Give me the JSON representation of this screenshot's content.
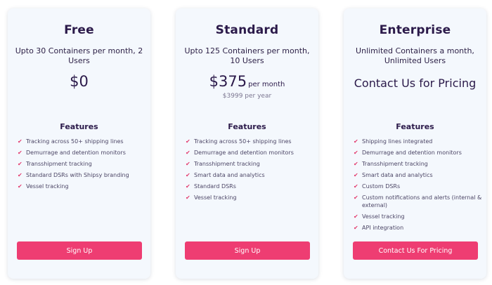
{
  "plans": [
    {
      "name": "Free",
      "description": "Upto 30 Containers per month, 2 Users",
      "price": "$0",
      "features_heading": "Features",
      "features": [
        "Tracking across 50+ shipping lines",
        "Demurrage and detention monitors",
        "Transshipment tracking",
        "Standard DSRs with Shipsy branding",
        "Vessel tracking"
      ],
      "cta_label": "Sign Up"
    },
    {
      "name": "Standard",
      "description": "Upto 125 Containers per month, 10 Users",
      "price": "$375",
      "price_period": "per month",
      "price_yearly": "$3999 per year",
      "features_heading": "Features",
      "features": [
        "Tracking across 50+ shipping lines",
        "Demurrage and detention monitors",
        "Transshipment tracking",
        "Smart data and analytics",
        "Standard DSRs",
        "Vessel tracking"
      ],
      "cta_label": "Sign Up"
    },
    {
      "name": "Enterprise",
      "description": "Unlimited Containers a month, Unlimited Users",
      "contact_text": "Contact Us for Pricing",
      "features_heading": "Features",
      "features": [
        "Shipping lines integrated",
        "Demurrage and detention monitors",
        "Transshipment tracking",
        "Smart data and analytics",
        "Custom DSRs",
        "Custom notifications and alerts (internal & external)",
        "Vessel tracking",
        "API integration"
      ],
      "cta_label": "Contact Us For Pricing"
    }
  ],
  "icons": {
    "feature_check": "check-icon"
  },
  "colors": {
    "accent": "#ee3d72",
    "check": "#e33a6e",
    "card_background": "#f4f8fd",
    "heading": "#2b1a4a"
  }
}
